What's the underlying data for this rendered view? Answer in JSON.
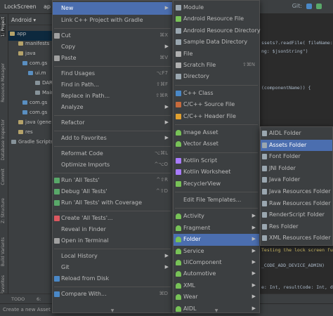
{
  "titlebar": {
    "crumb": "LockScreen",
    "crumb_app": "ap",
    "git_label": "Git:"
  },
  "left_tools": [
    "1: Project",
    "Resource Manager",
    "Database Inspector",
    "Commit",
    "Z: Structure",
    "Build Variants",
    "2: Favorites"
  ],
  "project_panel": {
    "header": "Android",
    "tree": [
      "app",
      "manifests",
      "java",
      "com.gs",
      "ui.m",
      "DAR",
      "Main",
      "com.gs",
      "com.gs",
      "java (gene",
      "res",
      "Gradle Scripts"
    ]
  },
  "editor": {
    "lines": [
      {
        "pre": "",
        "text": "ssets?.readFile( fileName: \"file"
      },
      {
        "pre": "",
        "text": "ng: $jsonString\")"
      },
      {
        "pre": "",
        "text": "(componentName)) {"
      },
      {
        "pre": "",
        "text": "Testing the lock screen funct"
      },
      {
        "pre": "",
        "text": "_CODE_ADD_DEVICE_ADMIN)"
      },
      {
        "pre": "",
        "text": "e: Int, resultCode: Int, data:"
      }
    ]
  },
  "bottom_bar": {
    "todo": "TODO",
    "git_partial": "6:"
  },
  "status_bar": {
    "text": "Create a new Asset"
  },
  "context_menu": {
    "items": [
      {
        "label": "New",
        "arrow": true,
        "highlight": true
      },
      {
        "label": "Link C++ Project with Gradle"
      },
      {
        "sep": true
      },
      {
        "label": "Cut",
        "shortcut": "⌘X",
        "icon": "scissors-icon"
      },
      {
        "label": "Copy",
        "arrow": true
      },
      {
        "label": "Paste",
        "shortcut": "⌘V",
        "icon": "clipboard-icon"
      },
      {
        "sep": true
      },
      {
        "label": "Find Usages",
        "shortcut": "⌥F7"
      },
      {
        "label": "Find in Path...",
        "shortcut": "⇧⌘F"
      },
      {
        "label": "Replace in Path...",
        "shortcut": "⇧⌘R"
      },
      {
        "label": "Analyze",
        "arrow": true
      },
      {
        "sep": true
      },
      {
        "label": "Refactor",
        "arrow": true
      },
      {
        "sep": true
      },
      {
        "label": "Add to Favorites",
        "arrow": true
      },
      {
        "sep": true
      },
      {
        "label": "Reformat Code",
        "shortcut": "⌥⌘L"
      },
      {
        "label": "Optimize Imports",
        "shortcut": "^⌥O"
      },
      {
        "sep": true
      },
      {
        "label": "Run 'All Tests'",
        "shortcut": "^⇧R",
        "icon": "run-icon"
      },
      {
        "label": "Debug 'All Tests'",
        "shortcut": "^⇧D",
        "icon": "debug-icon"
      },
      {
        "label": "Run 'All Tests' with Coverage",
        "icon": "coverage-icon"
      },
      {
        "sep": true
      },
      {
        "label": "Create 'All Tests'...",
        "icon": "create-test-icon"
      },
      {
        "label": "Reveal in Finder"
      },
      {
        "label": "Open in Terminal",
        "icon": "terminal-icon"
      },
      {
        "sep": true
      },
      {
        "label": "Local History",
        "arrow": true
      },
      {
        "label": "Git",
        "arrow": true
      },
      {
        "label": "Reload from Disk",
        "icon": "reload-icon"
      },
      {
        "sep": true
      },
      {
        "label": "Compare With...",
        "shortcut": "⌘D",
        "icon": "compare-icon"
      }
    ]
  },
  "new_submenu": {
    "items": [
      {
        "label": "Module",
        "icon": "module-icon"
      },
      {
        "label": "Android Resource File",
        "icon": "android-file-icon"
      },
      {
        "label": "Android Resource Directory",
        "icon": "folder-icon"
      },
      {
        "label": "Sample Data Directory",
        "icon": "folder-icon"
      },
      {
        "label": "File",
        "icon": "file-icon"
      },
      {
        "label": "Scratch File",
        "shortcut": "⇧⌘N",
        "icon": "scratch-icon"
      },
      {
        "label": "Directory",
        "icon": "folder-icon"
      },
      {
        "sep": true
      },
      {
        "label": "C++ Class",
        "icon": "cpp-icon"
      },
      {
        "label": "C/C++ Source File",
        "icon": "c-source-icon"
      },
      {
        "label": "C/C++ Header File",
        "icon": "c-header-icon"
      },
      {
        "sep": true
      },
      {
        "label": "Image Asset",
        "icon": "android-icon"
      },
      {
        "label": "Vector Asset",
        "icon": "android-icon"
      },
      {
        "sep": true
      },
      {
        "label": "Kotlin Script",
        "icon": "kotlin-icon"
      },
      {
        "label": "Kotlin Worksheet",
        "icon": "kotlin-icon"
      },
      {
        "label": "RecyclerView",
        "icon": "android-file-icon"
      },
      {
        "sep": true
      },
      {
        "label": "Edit File Templates..."
      },
      {
        "sep": true
      },
      {
        "label": "Activity",
        "arrow": true,
        "icon": "android-icon"
      },
      {
        "label": "Fragment",
        "arrow": true,
        "icon": "android-icon"
      },
      {
        "label": "Folder",
        "arrow": true,
        "icon": "android-icon",
        "highlight": true
      },
      {
        "label": "Service",
        "arrow": true,
        "icon": "android-icon"
      },
      {
        "label": "UiComponent",
        "arrow": true,
        "icon": "android-icon"
      },
      {
        "label": "Automotive",
        "arrow": true,
        "icon": "android-icon"
      },
      {
        "label": "XML",
        "arrow": true,
        "icon": "android-icon"
      },
      {
        "label": "Wear",
        "arrow": true,
        "icon": "android-icon"
      },
      {
        "label": "AIDL",
        "arrow": true,
        "icon": "android-icon"
      }
    ]
  },
  "folder_submenu": {
    "items": [
      {
        "label": "AIDL Folder"
      },
      {
        "label": "Assets Folder",
        "highlight": true
      },
      {
        "label": "Font Folder"
      },
      {
        "label": "JNI Folder"
      },
      {
        "label": "Java Folder"
      },
      {
        "label": "Java Resources Folder"
      },
      {
        "label": "Raw Resources Folder"
      },
      {
        "label": "RenderScript Folder"
      },
      {
        "label": "Res Folder"
      },
      {
        "label": "XML Resources Folder"
      }
    ]
  },
  "colors": {
    "menu_bg": "#3c3f41",
    "highlight": "#4b6eaf",
    "editor_bg": "#2b2b2b",
    "android_green": "#78c257",
    "folder_icon": "#9aa7b0"
  }
}
